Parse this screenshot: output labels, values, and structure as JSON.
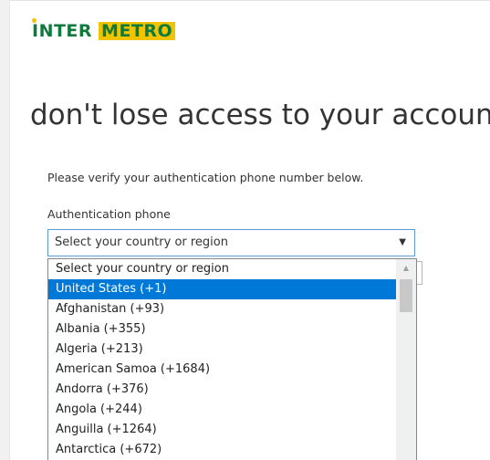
{
  "logo": {
    "part1": "INTER",
    "part2": "METRO"
  },
  "page": {
    "heading": "don't lose access to your account",
    "instruction": "Please verify your authentication phone number below.",
    "field_label": "Authentication phone"
  },
  "select": {
    "value": "Select your country or region",
    "arrow": "▼"
  },
  "dropdown": {
    "selected_index": 1,
    "options": [
      "Select your country or region",
      "United States (+1)",
      "Afghanistan (+93)",
      "Albania (+355)",
      "Algeria (+213)",
      "American Samoa (+1684)",
      "Andorra (+376)",
      "Angola (+244)",
      "Anguilla (+1264)",
      "Antarctica (+672)"
    ],
    "scroll_up_arrow": "▲"
  },
  "colors": {
    "brand_green": "#0e7a3b",
    "brand_yellow": "#f2c300",
    "selection_blue": "#0078d7",
    "focus_border": "#5b9bd5"
  },
  "icons": {
    "select_arrow": "chevron-down-icon",
    "scroll_up": "scroll-up-arrow-icon"
  }
}
